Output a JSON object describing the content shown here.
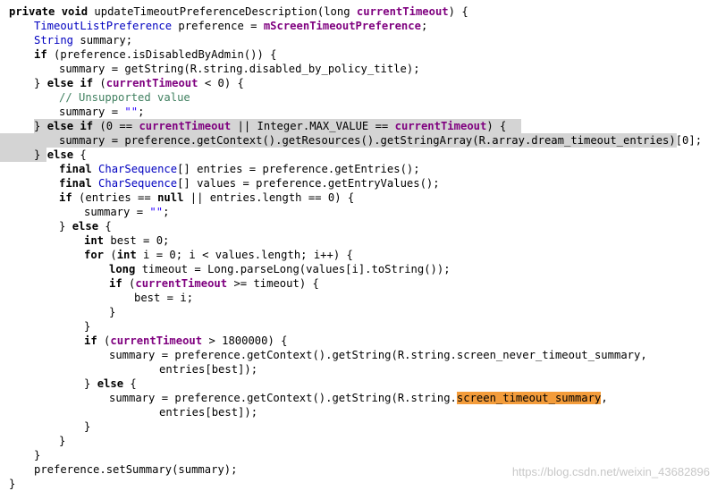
{
  "editor": {
    "highlight_color": "#d4d4d4",
    "selection_color": "#f39c3b",
    "lines": [
      {
        "indent": 0,
        "tokens": [
          [
            "k",
            "private void "
          ],
          [
            "n",
            "updateTimeoutPreferenceDescription"
          ],
          [
            "n",
            "(long "
          ],
          [
            "v",
            "currentTimeout"
          ],
          [
            "n",
            ") {"
          ]
        ]
      },
      {
        "indent": 1,
        "tokens": [
          [
            "t",
            "TimeoutListPreference"
          ],
          [
            "n",
            " preference = "
          ],
          [
            "f",
            "mScreenTimeoutPreference"
          ],
          [
            "n",
            ";"
          ]
        ]
      },
      {
        "indent": 1,
        "tokens": [
          [
            "t",
            "String"
          ],
          [
            "n",
            " summary;"
          ]
        ]
      },
      {
        "indent": 1,
        "tokens": [
          [
            "k",
            "if"
          ],
          [
            "n",
            " (preference.isDisabledByAdmin()) {"
          ]
        ]
      },
      {
        "indent": 2,
        "tokens": [
          [
            "n",
            "summary = getString(R.string.disabled_by_policy_title);"
          ]
        ]
      },
      {
        "indent": 1,
        "tokens": [
          [
            "n",
            "} "
          ],
          [
            "k",
            "else if"
          ],
          [
            "n",
            " ("
          ],
          [
            "v",
            "currentTimeout"
          ],
          [
            "n",
            " < 0) {"
          ]
        ]
      },
      {
        "indent": 2,
        "tokens": [
          [
            "c",
            "// Unsupported value"
          ]
        ]
      },
      {
        "indent": 2,
        "tokens": [
          [
            "n",
            "summary = "
          ],
          [
            "s",
            "\"\""
          ],
          [
            "n",
            ";"
          ]
        ]
      },
      {
        "indent": 1,
        "highlight": true,
        "tokens": [
          [
            "n",
            "} "
          ],
          [
            "k",
            "else if"
          ],
          [
            "n",
            " (0 == "
          ],
          [
            "v",
            "currentTimeout"
          ],
          [
            "n",
            " || Integer.MAX_VALUE == "
          ],
          [
            "v",
            "currentTimeout"
          ],
          [
            "n",
            ") {"
          ]
        ]
      },
      {
        "indent": 2,
        "highlight": true,
        "tokens": [
          [
            "n",
            "summary = preference.getContext().getResources().getStringArray(R.array.dream_timeout_entries)[0];"
          ]
        ]
      },
      {
        "indent": 1,
        "highlight": true,
        "tokens": [
          [
            "n",
            "} "
          ],
          [
            "k",
            "else"
          ],
          [
            "n",
            " {"
          ]
        ]
      },
      {
        "indent": 2,
        "tokens": [
          [
            "k",
            "final"
          ],
          [
            "n",
            " "
          ],
          [
            "t",
            "CharSequence"
          ],
          [
            "n",
            "[] entries = preference.getEntries();"
          ]
        ]
      },
      {
        "indent": 2,
        "tokens": [
          [
            "k",
            "final"
          ],
          [
            "n",
            " "
          ],
          [
            "t",
            "CharSequence"
          ],
          [
            "n",
            "[] values = preference.getEntryValues();"
          ]
        ]
      },
      {
        "indent": 2,
        "tokens": [
          [
            "k",
            "if"
          ],
          [
            "n",
            " (entries == "
          ],
          [
            "k",
            "null"
          ],
          [
            "n",
            " || entries.length == 0) {"
          ]
        ]
      },
      {
        "indent": 3,
        "tokens": [
          [
            "n",
            "summary = "
          ],
          [
            "s",
            "\"\""
          ],
          [
            "n",
            ";"
          ]
        ]
      },
      {
        "indent": 2,
        "tokens": [
          [
            "n",
            "} "
          ],
          [
            "k",
            "else"
          ],
          [
            "n",
            " {"
          ]
        ]
      },
      {
        "indent": 3,
        "tokens": [
          [
            "k",
            "int"
          ],
          [
            "n",
            " best = 0;"
          ]
        ]
      },
      {
        "indent": 3,
        "tokens": [
          [
            "k",
            "for"
          ],
          [
            "n",
            " ("
          ],
          [
            "k",
            "int"
          ],
          [
            "n",
            " i = 0; i < values.length; i++) {"
          ]
        ]
      },
      {
        "indent": 4,
        "tokens": [
          [
            "k",
            "long"
          ],
          [
            "n",
            " timeout = Long.parseLong(values[i].toString());"
          ]
        ]
      },
      {
        "indent": 4,
        "tokens": [
          [
            "k",
            "if"
          ],
          [
            "n",
            " ("
          ],
          [
            "v",
            "currentTimeout"
          ],
          [
            "n",
            " >= timeout) {"
          ]
        ]
      },
      {
        "indent": 5,
        "tokens": [
          [
            "n",
            "best = i;"
          ]
        ]
      },
      {
        "indent": 4,
        "tokens": [
          [
            "n",
            "}"
          ]
        ]
      },
      {
        "indent": 3,
        "tokens": [
          [
            "n",
            "}"
          ]
        ]
      },
      {
        "indent": 3,
        "tokens": [
          [
            "k",
            "if"
          ],
          [
            "n",
            " ("
          ],
          [
            "v",
            "currentTimeout"
          ],
          [
            "n",
            " > 1800000) {"
          ]
        ]
      },
      {
        "indent": 4,
        "tokens": [
          [
            "n",
            "summary = preference.getContext().getString(R.string.screen_never_timeout_summary,"
          ]
        ]
      },
      {
        "indent": 6,
        "tokens": [
          [
            "n",
            "entries[best]);"
          ]
        ]
      },
      {
        "indent": 3,
        "tokens": [
          [
            "n",
            "} "
          ],
          [
            "k",
            "else"
          ],
          [
            "n",
            " {"
          ]
        ]
      },
      {
        "indent": 4,
        "tokens": [
          [
            "n",
            "summary = preference.getContext().getString(R.string."
          ],
          [
            "sel",
            "screen_timeout_summary"
          ],
          [
            "n",
            ","
          ]
        ]
      },
      {
        "indent": 6,
        "tokens": [
          [
            "n",
            "entries[best]);"
          ]
        ]
      },
      {
        "indent": 3,
        "tokens": [
          [
            "n",
            "}"
          ]
        ]
      },
      {
        "indent": 2,
        "tokens": [
          [
            "n",
            "}"
          ]
        ]
      },
      {
        "indent": 1,
        "tokens": [
          [
            "n",
            "}"
          ]
        ]
      },
      {
        "indent": 1,
        "tokens": [
          [
            "n",
            "preference.setSummary(summary);"
          ]
        ]
      },
      {
        "indent": 0,
        "tokens": [
          [
            "n",
            "}"
          ]
        ]
      }
    ]
  },
  "watermark": "https://blog.csdn.net/weixin_43682896"
}
